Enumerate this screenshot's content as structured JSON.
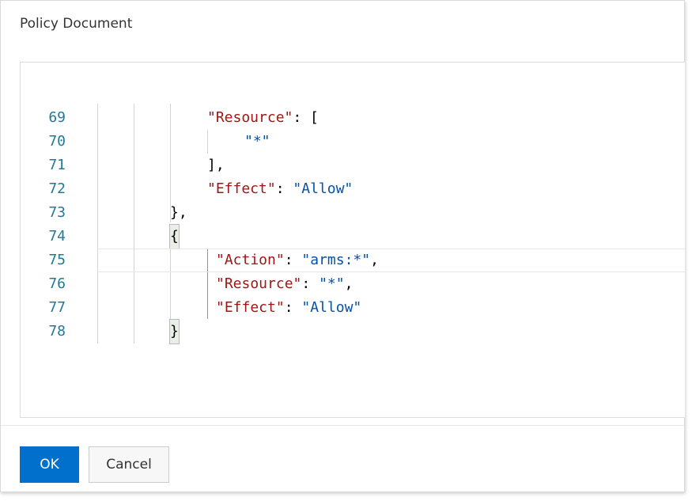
{
  "dialog": {
    "title": "Policy Document",
    "ok_label": "OK",
    "cancel_label": "Cancel"
  },
  "editor": {
    "lines": [
      {
        "num": "69",
        "tokens": [
          [
            "key",
            "\"Resource\""
          ],
          [
            "pun",
            ": ["
          ]
        ]
      },
      {
        "num": "70",
        "tokens": [
          [
            "str",
            "\"*\""
          ]
        ]
      },
      {
        "num": "71",
        "tokens": [
          [
            "pun",
            "],"
          ]
        ]
      },
      {
        "num": "72",
        "tokens": [
          [
            "key",
            "\"Effect\""
          ],
          [
            "pun",
            ": "
          ],
          [
            "str",
            "\"Allow\""
          ]
        ]
      },
      {
        "num": "73",
        "tokens": [
          [
            "pun",
            "},"
          ]
        ]
      },
      {
        "num": "74",
        "tokens": [
          [
            "match",
            "{"
          ]
        ]
      },
      {
        "num": "75",
        "tokens": [
          [
            "key",
            "\"Action\""
          ],
          [
            "pun",
            ": "
          ],
          [
            "str",
            "\"arms:*\""
          ],
          [
            "pun",
            ","
          ]
        ]
      },
      {
        "num": "76",
        "tokens": [
          [
            "key",
            "\"Resource\""
          ],
          [
            "pun",
            ": "
          ],
          [
            "str",
            "\"*\""
          ],
          [
            "pun",
            ","
          ]
        ]
      },
      {
        "num": "77",
        "tokens": [
          [
            "key",
            "\"Effect\""
          ],
          [
            "pun",
            ": "
          ],
          [
            "str",
            "\"Allow\""
          ]
        ]
      },
      {
        "num": "78",
        "tokens": [
          [
            "match",
            "}"
          ]
        ]
      }
    ]
  },
  "colors": {
    "primary_button": "#0070cc",
    "json_key": "#a31515",
    "json_string": "#0451a5",
    "line_number": "#237893"
  }
}
